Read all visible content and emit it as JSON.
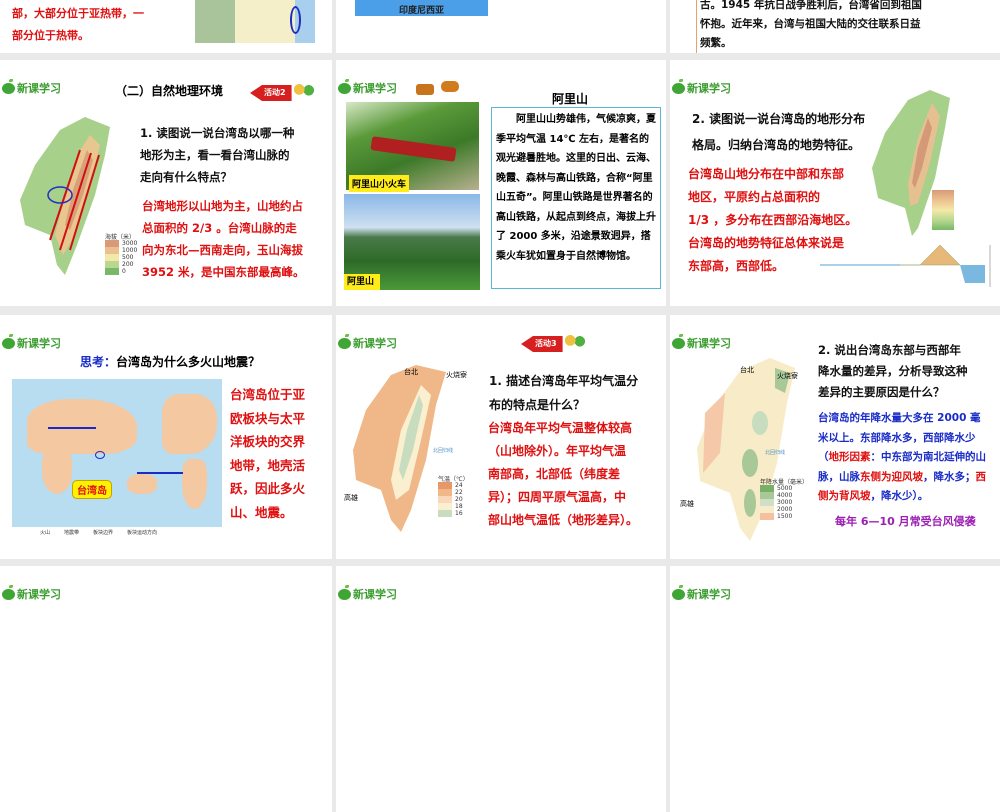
{
  "logo_label": "新课学习",
  "row0": {
    "left": {
      "lines": [
        "部，大部分位于亚热带，一",
        "部分位于热带。"
      ]
    },
    "middle": {
      "map_label": "印度尼西亚"
    },
    "right": {
      "lines": [
        "古。1945 年抗日战争胜利后，台湾省回到祖国",
        "怀抱。近年来，台湾与祖国大陆的交往联系日益",
        "频繁。"
      ]
    }
  },
  "slide_terrain": {
    "title": "（二）自然地理环境",
    "activity": "活动2",
    "question": [
      "1. 读图说一说台湾岛以哪一种",
      "地形为主，看一看台湾山脉的",
      "走向有什么特点？"
    ],
    "answer": [
      "台湾地形以山地为主，山地约占",
      "总面积的 2/3 。台湾山脉的走",
      "向为东北—西南走向，玉山海拔",
      "3952 米，是中国东部最高峰。"
    ],
    "legend_title": "海拔（米）",
    "legend": [
      "3000",
      "1000",
      "500",
      "200",
      "0"
    ]
  },
  "slide_alishan": {
    "title": "阿里山",
    "photo1_caption": "阿里山小火车",
    "photo2_caption": "阿里山",
    "paragraph": "阿里山山势雄伟，气候凉爽，夏季平均气温 14℃ 左右，是著名的观光避暑胜地。这里的日出、云海、晚霞、森林与高山铁路，合称“阿里山五奇”。阿里山铁路是世界著名的高山铁路，从起点到终点，海拔上升了 2000 多米，沿途景致迥异，搭乘火车犹如置身于自然博物馆。"
  },
  "slide_landform": {
    "question": [
      "2. 读图说一说台湾岛的地形分布",
      "格局。归纳台湾岛的地势特征。"
    ],
    "answer": [
      "台湾岛山地分布在中部和东部",
      "地区，平原约占总面积的",
      "1/3 ，多分布在西部沿海地区。",
      "台湾岛的地势特征总体来说是",
      "东部高，西部低。"
    ]
  },
  "slide_quake": {
    "think_label": "思考：",
    "question": "台湾岛为什么多火山地震？",
    "callout": "台湾岛",
    "answer": [
      "台湾岛位于亚",
      "欧板块与太平",
      "洋板块的交界",
      "地带，地壳活",
      "跃，因此多火",
      "山、地震。"
    ],
    "map_legend": [
      "火山",
      "地震带",
      "板块边界",
      "板块运动方向"
    ]
  },
  "slide_temp": {
    "activity": "活动3",
    "question": [
      "1. 描述台湾岛年平均气温分",
      "布的特点是什么？"
    ],
    "answer": [
      "台湾岛年平均气温整体较高",
      "（山地除外）。年平均气温",
      "南部高，北部低（纬度差",
      "异）；四周平原气温高，中",
      "部山地气温低（地形差异）。"
    ],
    "places": [
      "台北",
      "火烧寮",
      "高雄",
      "北回归线"
    ],
    "legend_title": "气温（℃）",
    "legend": [
      "24",
      "22",
      "20",
      "18",
      "16"
    ]
  },
  "slide_rain": {
    "question": [
      "2. 说出台湾岛东部与西部年",
      "降水量的差异，分析导致这种",
      "差异的主要原因是什么？"
    ],
    "answer_a": "台湾岛的年降水量大多在 2000 毫米以上。东部降水多，西部降水少（",
    "answer_b": "地形因素",
    "answer_c": "：中东部为南北延伸的山脉，山脉",
    "answer_d": "东侧为迎风坡",
    "answer_e": "，降水多；",
    "answer_f": "西侧为背风坡",
    "answer_g": "，降水少）。",
    "typhoon": "每年 6—10 月常受台风侵袭",
    "places": [
      "台北",
      "火烧寮",
      "高雄",
      "北回归线"
    ],
    "legend_title": "年降水量（毫米）",
    "legend": [
      "5000",
      "4000",
      "3000",
      "2000",
      "1500"
    ]
  }
}
